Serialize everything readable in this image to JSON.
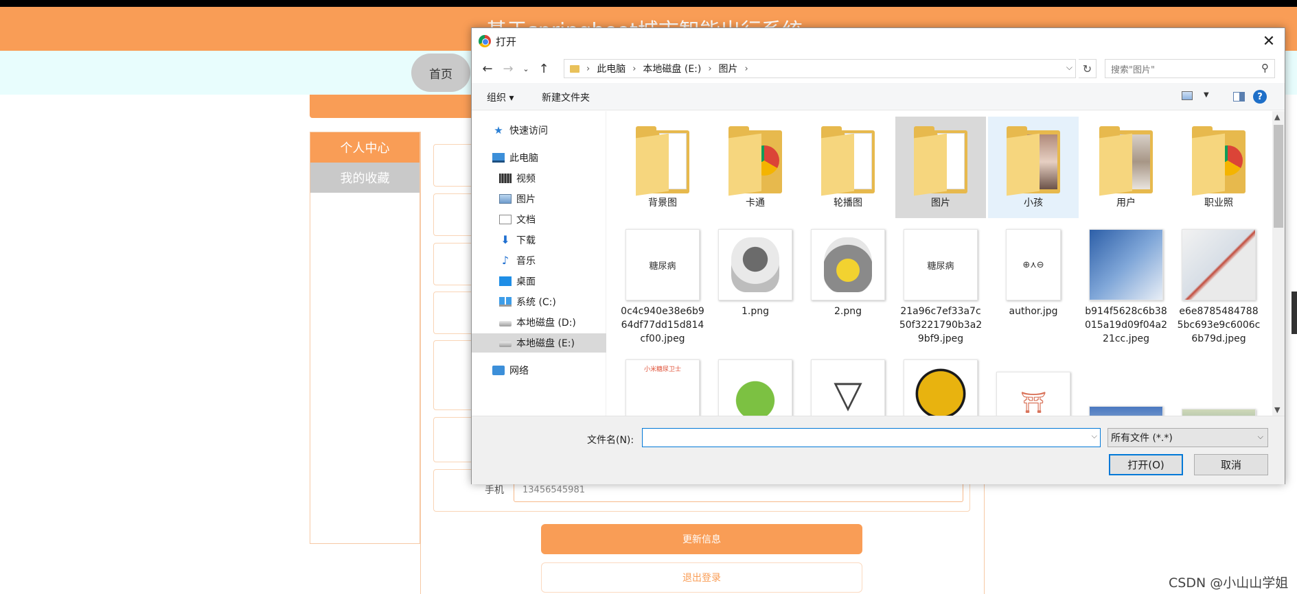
{
  "site": {
    "title": "基于springboot城市智能出行系统",
    "nav_home": "首页",
    "sidebar": [
      "个人中心",
      "我的收藏"
    ],
    "phone_label": "手机",
    "phone_value": "13456545981",
    "update_button": "更新信息",
    "logout_button": "退出登录",
    "colors": {
      "accent": "#f99d56",
      "nav_bg": "#e8fdfd"
    }
  },
  "watermark": "CSDN @小山山学姐",
  "dialog": {
    "title": "打开",
    "breadcrumb": [
      "此电脑",
      "本地磁盘 (E:)",
      "图片"
    ],
    "search_placeholder": "搜索\"图片\"",
    "toolbar": {
      "organize": "组织 ▾",
      "new_folder": "新建文件夹",
      "help": "?"
    },
    "nav_tree": [
      {
        "label": "快速访问",
        "icon": "star-icon"
      },
      {
        "label": "此电脑",
        "icon": "computer-icon"
      },
      {
        "label": "视频",
        "icon": "video-icon"
      },
      {
        "label": "图片",
        "icon": "pictures-icon"
      },
      {
        "label": "文档",
        "icon": "documents-icon"
      },
      {
        "label": "下载",
        "icon": "download-icon"
      },
      {
        "label": "音乐",
        "icon": "music-icon"
      },
      {
        "label": "桌面",
        "icon": "desktop-icon"
      },
      {
        "label": "系统 (C:)",
        "icon": "windows-drive-icon"
      },
      {
        "label": "本地磁盘 (D:)",
        "icon": "drive-icon"
      },
      {
        "label": "本地磁盘 (E:)",
        "icon": "drive-icon",
        "selected": true
      },
      {
        "label": "网络",
        "icon": "network-icon"
      }
    ],
    "folders": [
      "背景图",
      "卡通",
      "轮播图",
      "图片",
      "小孩",
      "用户",
      "职业照"
    ],
    "files": [
      {
        "name": "0c4c940e38e6b964df77dd15d814cf00.jpeg",
        "caption": "糖尿病"
      },
      {
        "name": "1.png",
        "caption": ""
      },
      {
        "name": "2.png",
        "caption": ""
      },
      {
        "name": "21a96c7ef33a7c50f3221790b3a29bf9.jpeg",
        "caption": "糖尿病"
      },
      {
        "name": "author.jpg",
        "caption": "⊕⋏⊖"
      },
      {
        "name": "b914f5628c6b38015a19d09f04a221cc.jpeg",
        "caption": ""
      },
      {
        "name": "e6e87854847885bc693e9c6006c6b79d.jpeg",
        "caption": ""
      }
    ],
    "partial_row_caption": "小米糖尿卫士",
    "filename_label": "文件名(N):",
    "filename_value": "",
    "file_type": "所有文件 (*.*)",
    "open_button": "打开(O)",
    "cancel_button": "取消"
  }
}
